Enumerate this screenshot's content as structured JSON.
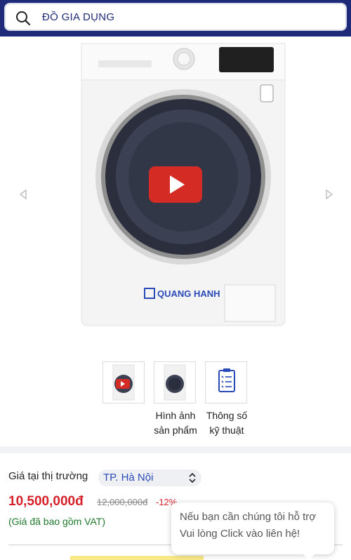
{
  "search": {
    "text": "ĐỒ GIA DỤNG"
  },
  "product_image": {
    "brand_watermark": "QUANG HANH",
    "has_video": true
  },
  "thumbnails": [
    {
      "type": "video",
      "label": ""
    },
    {
      "type": "image",
      "label": ""
    },
    {
      "type": "specs",
      "label": ""
    }
  ],
  "labels": {
    "images": [
      "Hình ảnh",
      "sản phẩm"
    ],
    "specs": [
      "Thông số",
      "kỹ thuật"
    ]
  },
  "pricing": {
    "market_label": "Giá tại thị trường",
    "city": "TP. Hà Nội",
    "price": "10,500,000đ",
    "old_price": "12,000,000đ",
    "discount": "-12%",
    "vat_note": "(Giá đã bao gồm VAT)"
  },
  "tooltip": {
    "line1": "Nếu bạn cần chúng tôi hỗ trợ",
    "line2": "Vui lòng Click vào liên hệ!"
  },
  "colors": {
    "header": "#1f2b78",
    "price": "#d6202a",
    "vat": "#1f7a2e",
    "play": "#d42b25"
  }
}
